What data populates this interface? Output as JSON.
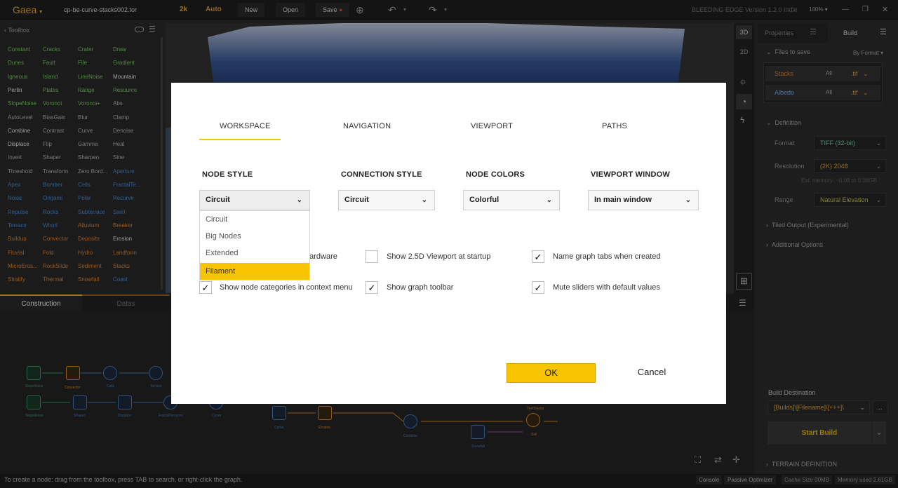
{
  "app": {
    "name": "Gaea",
    "file_tab": "cp-be-curve-stacks002.tor",
    "resolution": "2k",
    "mode": "Auto",
    "new_label": "New",
    "open_label": "Open",
    "save_label": "Save",
    "version": "BLEEDING EDGE Version 1.2.0 Indie",
    "zoom": "100%"
  },
  "toolbox": {
    "title": "Toolbox",
    "columns": [
      [
        "Constant",
        "Dunes",
        "Igneous",
        "Perlin",
        "SlopeNoise",
        "AutoLevel",
        "Combine",
        "Displace",
        "Invert",
        "Threshold",
        "Apex",
        "Noise",
        "Repulse",
        "Terrace",
        "Buildup",
        "Fluvial",
        "MicroEros...",
        "Stratify"
      ],
      [
        "Cracks",
        "Fault",
        "Island",
        "Plates",
        "Voronoi",
        "BiasGain",
        "Contrast",
        "Flip",
        "Shaper",
        "Transform",
        "Bomber",
        "Origami",
        "Rocks",
        "Whorl",
        "Convector",
        "Fold",
        "RockSlide",
        "Thermal"
      ],
      [
        "Crater",
        "File",
        "LineNoise",
        "Range",
        "Voronoi+",
        "Blur",
        "Curve",
        "Gamma",
        "Sharpen",
        "Zero Bord...",
        "Cells",
        "Polar",
        "Subterrace",
        "Alluvium",
        "Deposits",
        "Hydro",
        "Sediment",
        "Snowfall"
      ],
      [
        "Draw",
        "Gradient",
        "Mountain",
        "Resource",
        "Abs",
        "Clamp",
        "Denoise",
        "Heal",
        "Sine",
        "Aperture",
        "FractalTe...",
        "Recurve",
        "Swirl",
        "Breaker",
        "Erosion",
        "Landform",
        "Stacks",
        "Coast"
      ]
    ]
  },
  "tabs": {
    "construction": "Construction",
    "datas": "Datas"
  },
  "graph": {
    "nodes": [
      "SlopeNoise",
      "Convector",
      "Cells",
      "Terrace",
      "SlopeNoise",
      "Shaper",
      "Displace",
      "FractalTerraces",
      "Curve",
      "Curve",
      "Erosion",
      "Combine",
      "Snowfall",
      "Soil",
      "TextStacks"
    ]
  },
  "status": {
    "hint": "To create a node: drag from the toolbox, press TAB to search, or right-click the graph.",
    "console": "Console",
    "optimizer": "Passive Optimizer",
    "cache": "Cache Size 00MB",
    "memory": "Memory used 2.61GB"
  },
  "viewbar": {
    "btn_3d": "3D",
    "btn_2d": "2D"
  },
  "right_panel": {
    "tab_properties": "Properties",
    "tab_build": "Build",
    "files_to_save": "Files to save",
    "by_format": "By Format",
    "files": [
      {
        "name": "Stacks",
        "scope": "All",
        "ext": ".tif"
      },
      {
        "name": "Albedo",
        "scope": "All",
        "ext": ".tif"
      }
    ],
    "definition": "Definition",
    "format_label": "Format",
    "format_value": "TIFF (32-bit)",
    "resolution_label": "Resolution",
    "resolution_value": "(2K) 2048",
    "est_memory": "Est. memory: ~0.08 to 0.08GB",
    "range_label": "Range",
    "range_value": "Natural Elevation",
    "tiled_output": "Tiled Output (Experimental)",
    "additional_options": "Additional Options",
    "build_destination_label": "Build Destination",
    "build_destination": "[Builds]\\[Filename]\\[+++]\\",
    "browse": "...",
    "start_build": "Start Build",
    "terrain_definition": "TERRAIN DEFINITION"
  },
  "dialog": {
    "tabs": [
      "WORKSPACE",
      "NAVIGATION",
      "VIEWPORT",
      "PATHS"
    ],
    "active_tab": "WORKSPACE",
    "groups": [
      {
        "label": "NODE STYLE",
        "value": "Circuit"
      },
      {
        "label": "CONNECTION STYLE",
        "value": "Circuit"
      },
      {
        "label": "NODE COLORS",
        "value": "Colorful"
      },
      {
        "label": "VIEWPORT WINDOW",
        "value": "In main window"
      }
    ],
    "dropdown_options": [
      "Circuit",
      "Big Nodes",
      "Extended",
      "Filament"
    ],
    "dropdown_highlight": "Filament",
    "checkboxes": [
      {
        "label": "hardware",
        "checked": false
      },
      {
        "label": "Show 2.5D Viewport at startup",
        "checked": false
      },
      {
        "label": "Name graph tabs when created",
        "checked": true
      },
      {
        "label": "Show node categories in context menu",
        "checked": true
      },
      {
        "label": "Show graph toolbar",
        "checked": true
      },
      {
        "label": "Mute sliders with default values",
        "checked": true
      }
    ],
    "ok_label": "OK",
    "cancel_label": "Cancel",
    "accent": "#f8c400"
  }
}
